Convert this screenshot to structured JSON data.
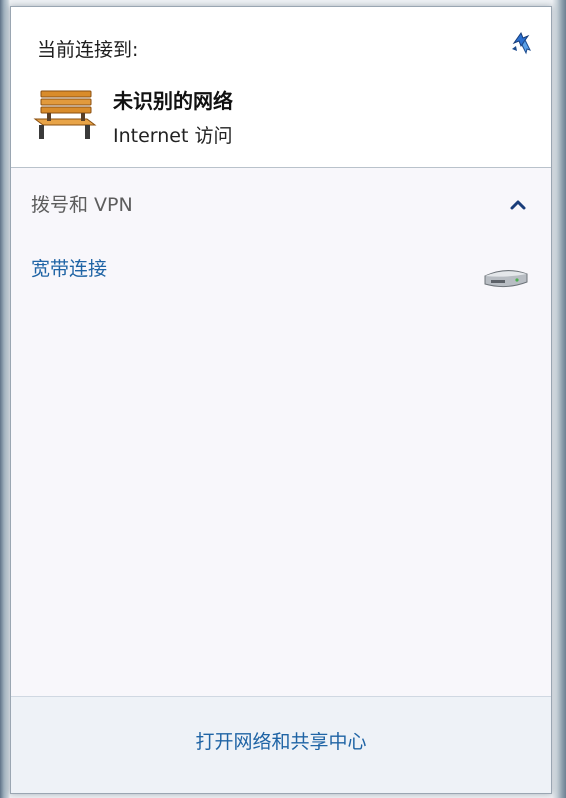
{
  "current": {
    "heading": "当前连接到:",
    "network_name": "未识别的网络",
    "access_status": "Internet 访问",
    "network_icon": "bench-icon",
    "refresh_icon": "refresh-icon"
  },
  "vpn_section": {
    "header": "拨号和 VPN",
    "collapse_icon": "chevron-up-icon",
    "items": [
      {
        "label": "宽带连接",
        "icon": "modem-icon"
      }
    ]
  },
  "footer": {
    "link": "打开网络和共享中心"
  },
  "colors": {
    "link_blue": "#1f64a5",
    "chevron_blue": "#1a3d7a",
    "panel_bg": "#ffffff",
    "footer_bg": "#eef2f7"
  }
}
